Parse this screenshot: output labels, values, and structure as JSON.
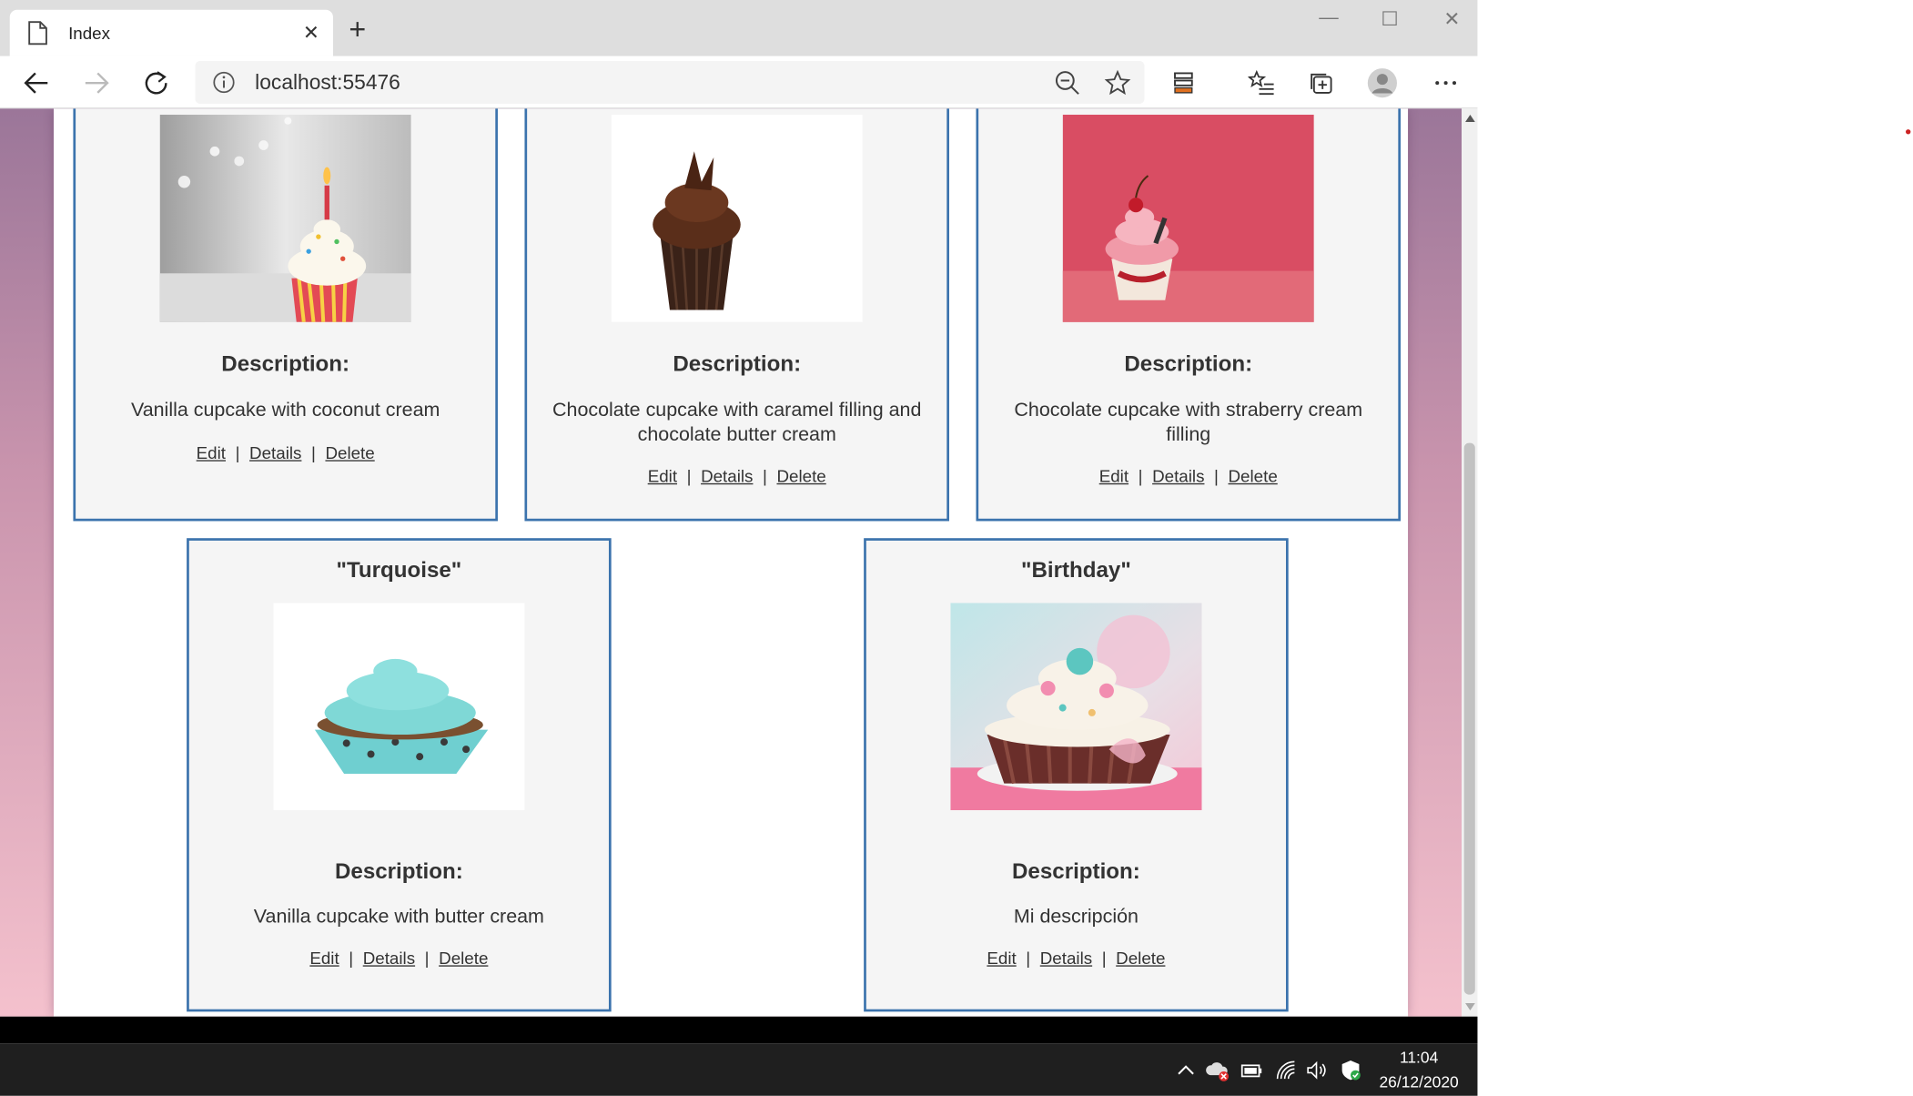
{
  "browser": {
    "tab_title": "Index",
    "tab_close": "✕",
    "new_tab": "+",
    "url": "localhost:55476",
    "window_controls": {
      "minimize": "—",
      "maximize": "☐",
      "close": "✕"
    }
  },
  "cards_top": [
    {
      "desc_label": "Description:",
      "desc_text": "Vanilla cupcake with coconut cream",
      "actions": {
        "edit": "Edit",
        "details": "Details",
        "delete": "Delete",
        "sep": "|"
      }
    },
    {
      "desc_label": "Description:",
      "desc_text": "Chocolate cupcake with caramel filling and chocolate butter cream",
      "actions": {
        "edit": "Edit",
        "details": "Details",
        "delete": "Delete",
        "sep": "|"
      }
    },
    {
      "desc_label": "Description:",
      "desc_text": "Chocolate cupcake with straberry cream filling",
      "actions": {
        "edit": "Edit",
        "details": "Details",
        "delete": "Delete",
        "sep": "|"
      }
    }
  ],
  "cards_bottom": [
    {
      "title": "\"Turquoise\"",
      "desc_label": "Description:",
      "desc_text": "Vanilla cupcake with butter cream",
      "actions": {
        "edit": "Edit",
        "details": "Details",
        "delete": "Delete",
        "sep": "|"
      }
    },
    {
      "title": "\"Birthday\"",
      "desc_label": "Description:",
      "desc_text": "Mi descripción",
      "actions": {
        "edit": "Edit",
        "details": "Details",
        "delete": "Delete",
        "sep": "|"
      }
    }
  ],
  "taskbar": {
    "time": "11:04",
    "date": "26/12/2020"
  },
  "colors": {
    "card_border": "#3b73ad",
    "card_bg": "#f5f5f5",
    "page_gradient_top": "#9b7699",
    "page_gradient_bottom": "#f4c1cd",
    "taskbar": "#1f1f1f"
  }
}
